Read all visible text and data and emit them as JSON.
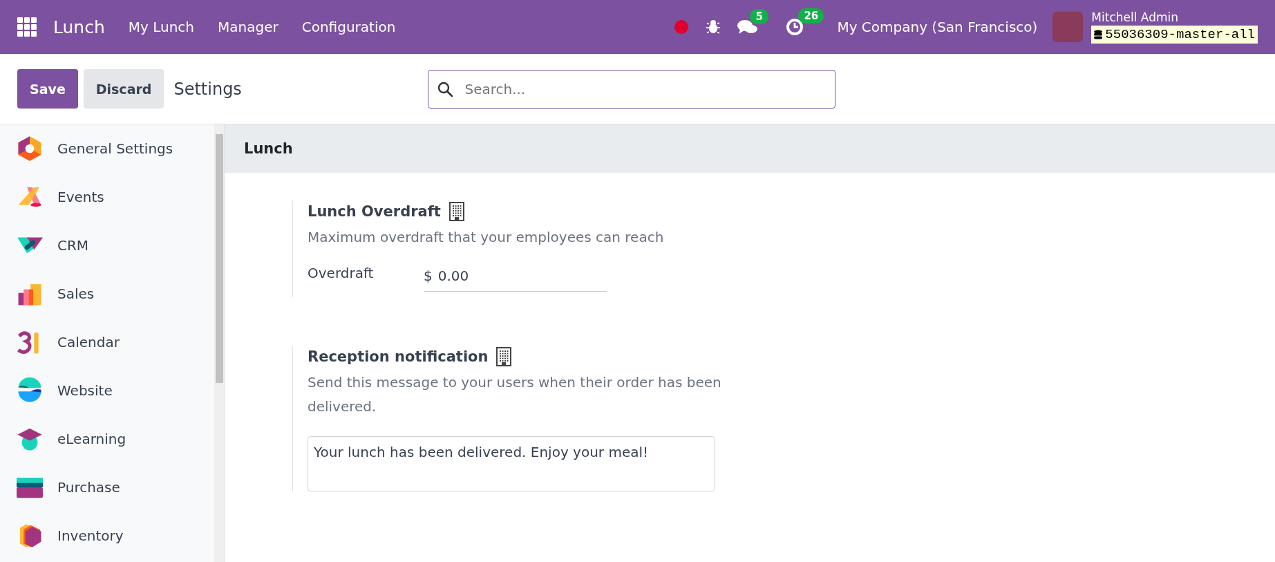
{
  "navbar": {
    "app_name": "Lunch",
    "menu": [
      {
        "label": "My Lunch"
      },
      {
        "label": "Manager"
      },
      {
        "label": "Configuration"
      }
    ],
    "messages_count": "5",
    "activities_count": "26",
    "company": "My Company (San Francisco)",
    "user": "Mitchell Admin",
    "database": "55036309-master-all"
  },
  "control_panel": {
    "buttons": [
      {
        "label": "Save",
        "kind": "primary"
      },
      {
        "label": "Discard",
        "kind": "secondary"
      }
    ],
    "breadcrumb": "Settings",
    "search": {
      "placeholder": "Search..."
    }
  },
  "sidebar": {
    "items": [
      {
        "label": "General Settings",
        "selected": false
      },
      {
        "label": "Events",
        "selected": false
      },
      {
        "label": "CRM",
        "selected": false
      },
      {
        "label": "Sales",
        "selected": false
      },
      {
        "label": "Calendar",
        "selected": false
      },
      {
        "label": "Website",
        "selected": false
      },
      {
        "label": "eLearning",
        "selected": false
      },
      {
        "label": "Purchase",
        "selected": false
      },
      {
        "label": "Inventory",
        "selected": false
      }
    ]
  },
  "section": {
    "title": "Lunch",
    "settings": [
      {
        "kind": "field",
        "title": "Lunch Overdraft",
        "description": "Maximum overdraft that your employees can reach",
        "field_label": "Overdraft",
        "currency": "$",
        "value": "0.00"
      },
      {
        "kind": "textarea",
        "title": "Reception notification",
        "description": "Send this message to your users when their order has been delivered.",
        "value": "Your lunch has been delivered. Enjoy your meal!"
      }
    ]
  }
}
